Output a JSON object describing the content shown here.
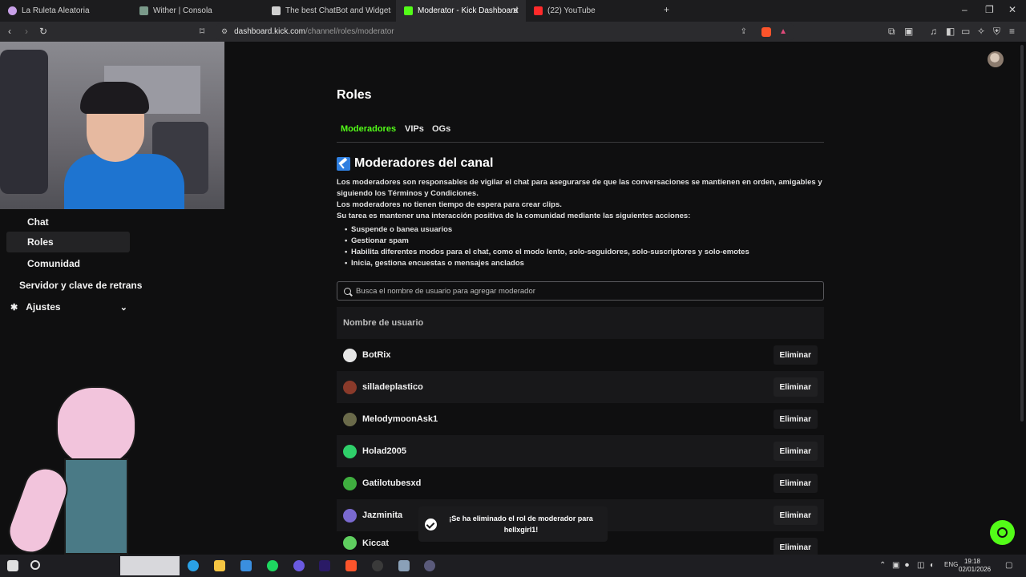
{
  "browser": {
    "tabs": [
      {
        "label": "La Ruleta Aleatoria",
        "favicon_color": "#c8a0e8",
        "active": false
      },
      {
        "label": "Wither | Consola",
        "favicon_color": "#7a9a8a",
        "active": false
      },
      {
        "label": "The best ChatBot and Widgets for Ki",
        "favicon_color": "#d0d0d0",
        "active": false
      },
      {
        "label": "Moderator - Kick Dashboard",
        "favicon_color": "#53fc18",
        "active": true
      },
      {
        "label": "(22) YouTube",
        "favicon_color": "#ff2a2a",
        "active": false
      }
    ],
    "url_host": "dashboard.kick.com",
    "url_path": "/channel/roles/moderator"
  },
  "sidebar": {
    "items": [
      {
        "label": "Chat"
      },
      {
        "label": "Roles",
        "active": true
      },
      {
        "label": "Comunidad"
      },
      {
        "label": "Servidor y clave de retrans"
      },
      {
        "label": "Ajustes"
      }
    ]
  },
  "main": {
    "title": "Roles",
    "tabs": [
      {
        "label": "Moderadores",
        "active": true
      },
      {
        "label": "VIPs"
      },
      {
        "label": "OGs"
      }
    ],
    "section_title": "Moderadores del canal",
    "description": [
      "Los moderadores son responsables de vigilar el chat para asegurarse de que las conversaciones se mantienen en orden, amigables y siguiendo los Términos y Condiciones.",
      "Los moderadores no tienen tiempo de espera para crear clips.",
      "Su tarea es mantener una interacción positiva de la comunidad mediante las siguientes acciones:"
    ],
    "bullets": [
      "Suspende o banea usuarios",
      "Gestionar spam",
      "Habilita diferentes modos para el chat, como el modo lento, solo-seguidores, solo-suscriptores y solo-emotes",
      "Inicia, gestiona encuestas o mensajes anclados"
    ],
    "search_placeholder": "Busca el nombre de usuario para agregar moderador",
    "table_header": "Nombre de usuario",
    "remove_label": "Eliminar",
    "moderators": [
      {
        "name": "BotRix",
        "avatar_color": "#e6e6e6"
      },
      {
        "name": "silladeplastico",
        "avatar_color": "#8a3a2a"
      },
      {
        "name": "MelodymoonAsk1",
        "avatar_color": "#6a6a4a"
      },
      {
        "name": "Holad2005",
        "avatar_color": "#2fd06a"
      },
      {
        "name": "Gatilotubesxd",
        "avatar_color": "#3fae3f"
      },
      {
        "name": "Jazminita",
        "avatar_color": "#7a6ad0"
      },
      {
        "name": "Kiccat",
        "avatar_color": "#5fcf5f"
      }
    ],
    "toast": "¡Se ha eliminado el rol de moderador para hellxgirl1!"
  },
  "taskbar": {
    "language": "ENG",
    "time": "19:18",
    "date": "02/01/2026"
  },
  "colors": {
    "accent": "#53fc18",
    "background": "#0f0f10"
  }
}
